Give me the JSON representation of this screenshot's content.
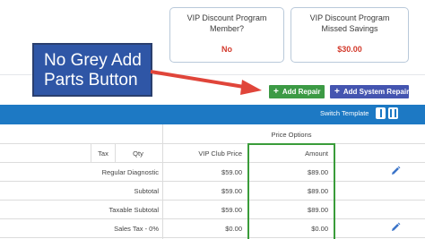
{
  "cards": {
    "member": {
      "title": "VIP Discount Program Member?",
      "value": "No"
    },
    "savings": {
      "title": "VIP Discount Program Missed Savings",
      "value": "$30.00"
    }
  },
  "callout": {
    "text_line1": "No Grey Add",
    "text_line2": "Parts Button"
  },
  "buttons": {
    "add_repair": "Add Repair",
    "add_system_repair": "Add System Repair"
  },
  "toolbar": {
    "switch_template": "Switch Template"
  },
  "table": {
    "group_header": "Price Options",
    "columns": {
      "tax": "Tax",
      "qty": "Qty",
      "vip_price": "VIP Club Price",
      "amount": "Amount"
    },
    "rows": [
      {
        "label": "Regular Diagnostic",
        "vip": "$59.00",
        "amount": "$89.00"
      },
      {
        "label": "Subtotal",
        "vip": "$59.00",
        "amount": "$89.00"
      },
      {
        "label": "Taxable Subtotal",
        "vip": "$59.00",
        "amount": "$89.00"
      },
      {
        "label": "Sales Tax - 0%",
        "vip": "$0.00",
        "amount": "$0.00"
      }
    ]
  },
  "colors": {
    "callout_bg": "#2f56a6",
    "bar": "#1d79c4",
    "highlight": "#3a9c3a",
    "add_repair": "#3c9a45",
    "add_system": "#4455b0",
    "value_red": "#d33a2c"
  }
}
